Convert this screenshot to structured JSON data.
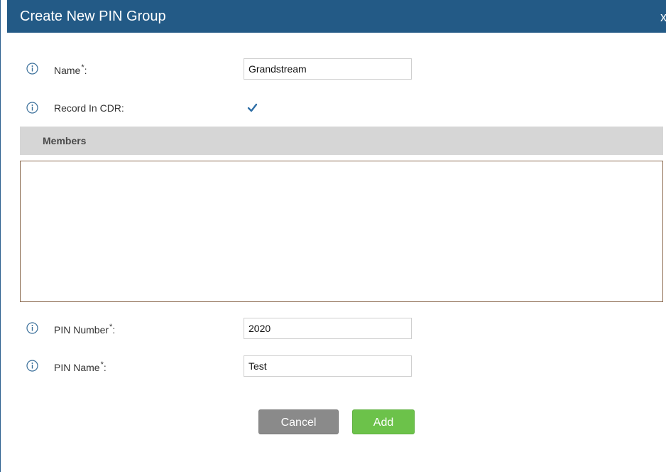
{
  "dialog": {
    "title": "Create New PIN Group",
    "close_label": "x"
  },
  "fields": {
    "name": {
      "label": "Name",
      "required_mark": "*",
      "colon": ":",
      "value": "Grandstream"
    },
    "record_in_cdr": {
      "label": "Record In CDR:",
      "checked": true
    },
    "pin_number": {
      "label": "PIN Number",
      "required_mark": "*",
      "colon": ":",
      "value": "2020"
    },
    "pin_name": {
      "label": "PIN Name",
      "required_mark": "*",
      "colon": ":",
      "value": "Test"
    }
  },
  "members": {
    "title": "Members"
  },
  "buttons": {
    "cancel_label": "Cancel",
    "add_label": "Add"
  },
  "colors": {
    "title_bar": "#235a86",
    "add_button": "#6cc24a",
    "cancel_button": "#8a8a8a",
    "section_header": "#d6d6d6"
  },
  "icons": {
    "info": "info-circle-icon",
    "checkmark": "checkmark-icon"
  }
}
